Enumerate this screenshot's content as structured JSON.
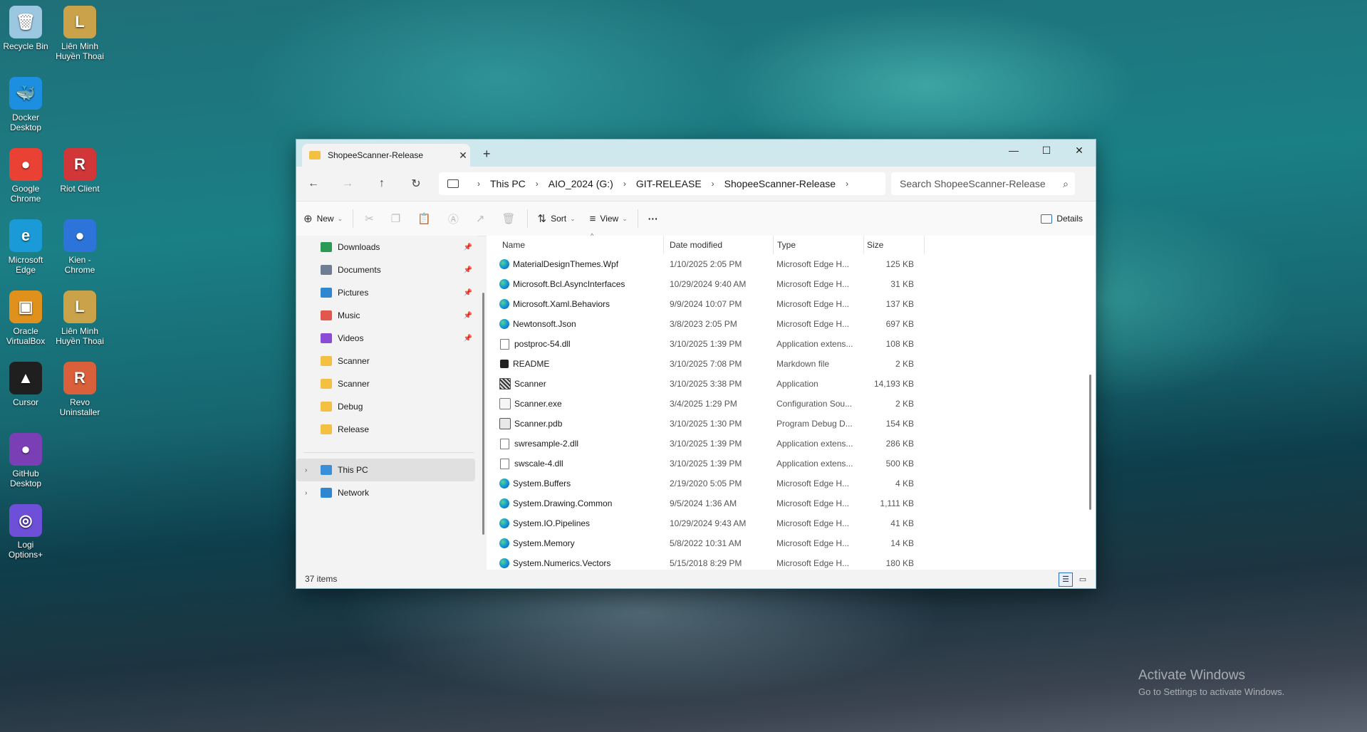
{
  "desktop": {
    "icons": [
      {
        "label1": "Recycle Bin",
        "label2": "",
        "glyph": "🗑",
        "color": "#9cc7e0"
      },
      {
        "label1": "Liên Minh",
        "label2": "Huyền Thoại",
        "glyph": "L",
        "color": "#c9a24a"
      },
      {
        "label1": "Docker",
        "label2": "Desktop",
        "glyph": "🐳",
        "color": "#1d8fe0"
      },
      {
        "label1": "Google",
        "label2": "Chrome",
        "glyph": "●",
        "color": "#e94235"
      },
      {
        "label1": "Riot Client",
        "label2": "",
        "glyph": "R",
        "color": "#d13639"
      },
      {
        "label1": "Microsoft",
        "label2": "Edge",
        "glyph": "e",
        "color": "#1a9bd7"
      },
      {
        "label1": "Kien -",
        "label2": "Chrome",
        "glyph": "●",
        "color": "#2d74da"
      },
      {
        "label1": "Oracle",
        "label2": "VirtualBox",
        "glyph": "▣",
        "color": "#e0911c"
      },
      {
        "label1": "Liên Minh",
        "label2": "Huyền Thoại",
        "glyph": "L",
        "color": "#c9a24a"
      },
      {
        "label1": "Cursor",
        "label2": "",
        "glyph": "▲",
        "color": "#1f1f1f"
      },
      {
        "label1": "Revo",
        "label2": "Uninstaller",
        "glyph": "R",
        "color": "#d9603a"
      },
      {
        "label1": "GitHub",
        "label2": "Desktop",
        "glyph": "●",
        "color": "#7b3fb5"
      },
      {
        "label1": "Logi",
        "label2": "Options+",
        "glyph": "◎",
        "color": "#6d4fd8"
      }
    ],
    "watermark_title": "Activate Windows",
    "watermark_sub": "Go to Settings to activate Windows."
  },
  "window": {
    "tab_title": "ShopeeScanner-Release",
    "new_tab": "+",
    "controls": {
      "minimize": "—",
      "maximize": "☐",
      "close": "✕"
    },
    "breadcrumbs": [
      "This PC",
      "AIO_2024 (G:)",
      "GIT-RELEASE",
      "ShopeeScanner-Release"
    ],
    "search_placeholder": "Search ShopeeScanner-Release",
    "toolbar": {
      "new": "New",
      "sort": "Sort",
      "view": "View",
      "more": "···",
      "details": "Details"
    },
    "nav": {
      "quick": [
        {
          "label": "Downloads",
          "color": "#2b9a55",
          "pinned": true
        },
        {
          "label": "Documents",
          "color": "#6f7d95",
          "pinned": true
        },
        {
          "label": "Pictures",
          "color": "#2f86d1",
          "pinned": true
        },
        {
          "label": "Music",
          "color": "#e2564e",
          "pinned": true
        },
        {
          "label": "Videos",
          "color": "#8a4bd6",
          "pinned": true
        },
        {
          "label": "Scanner",
          "color": "#f4c042",
          "pinned": false
        },
        {
          "label": "Scanner",
          "color": "#f4c042",
          "pinned": false
        },
        {
          "label": "Debug",
          "color": "#f4c042",
          "pinned": false
        },
        {
          "label": "Release",
          "color": "#f4c042",
          "pinned": false
        }
      ],
      "this_pc": "This PC",
      "network": "Network"
    },
    "columns": {
      "name": "Name",
      "date": "Date modified",
      "type": "Type",
      "size": "Size"
    },
    "files": [
      {
        "name": "MaterialDesignThemes.Wpf",
        "date": "1/10/2025 2:05 PM",
        "type": "Microsoft Edge H...",
        "size": "125 KB",
        "icon": "edge"
      },
      {
        "name": "Microsoft.Bcl.AsyncInterfaces",
        "date": "10/29/2024 9:40 AM",
        "type": "Microsoft Edge H...",
        "size": "31 KB",
        "icon": "edge"
      },
      {
        "name": "Microsoft.Xaml.Behaviors",
        "date": "9/9/2024 10:07 PM",
        "type": "Microsoft Edge H...",
        "size": "137 KB",
        "icon": "edge"
      },
      {
        "name": "Newtonsoft.Json",
        "date": "3/8/2023 2:05 PM",
        "type": "Microsoft Edge H...",
        "size": "697 KB",
        "icon": "edge"
      },
      {
        "name": "postproc-54.dll",
        "date": "3/10/2025 1:39 PM",
        "type": "Application extens...",
        "size": "108 KB",
        "icon": "dll"
      },
      {
        "name": "README",
        "date": "3/10/2025 7:08 PM",
        "type": "Markdown file",
        "size": "2 KB",
        "icon": "md"
      },
      {
        "name": "Scanner",
        "date": "3/10/2025 3:38 PM",
        "type": "Application",
        "size": "14,193 KB",
        "icon": "app"
      },
      {
        "name": "Scanner.exe",
        "date": "3/4/2025 1:29 PM",
        "type": "Configuration Sou...",
        "size": "2 KB",
        "icon": "cfg"
      },
      {
        "name": "Scanner.pdb",
        "date": "3/10/2025 1:30 PM",
        "type": "Program Debug D...",
        "size": "154 KB",
        "icon": "pdb"
      },
      {
        "name": "swresample-2.dll",
        "date": "3/10/2025 1:39 PM",
        "type": "Application extens...",
        "size": "286 KB",
        "icon": "dll"
      },
      {
        "name": "swscale-4.dll",
        "date": "3/10/2025 1:39 PM",
        "type": "Application extens...",
        "size": "500 KB",
        "icon": "dll"
      },
      {
        "name": "System.Buffers",
        "date": "2/19/2020 5:05 PM",
        "type": "Microsoft Edge H...",
        "size": "4 KB",
        "icon": "edge"
      },
      {
        "name": "System.Drawing.Common",
        "date": "9/5/2024 1:36 AM",
        "type": "Microsoft Edge H...",
        "size": "1,111 KB",
        "icon": "edge"
      },
      {
        "name": "System.IO.Pipelines",
        "date": "10/29/2024 9:43 AM",
        "type": "Microsoft Edge H...",
        "size": "41 KB",
        "icon": "edge"
      },
      {
        "name": "System.Memory",
        "date": "5/8/2022 10:31 AM",
        "type": "Microsoft Edge H...",
        "size": "14 KB",
        "icon": "edge"
      },
      {
        "name": "System.Numerics.Vectors",
        "date": "5/15/2018 8:29 PM",
        "type": "Microsoft Edge H...",
        "size": "180 KB",
        "icon": "edge"
      }
    ],
    "status": "37 items"
  }
}
